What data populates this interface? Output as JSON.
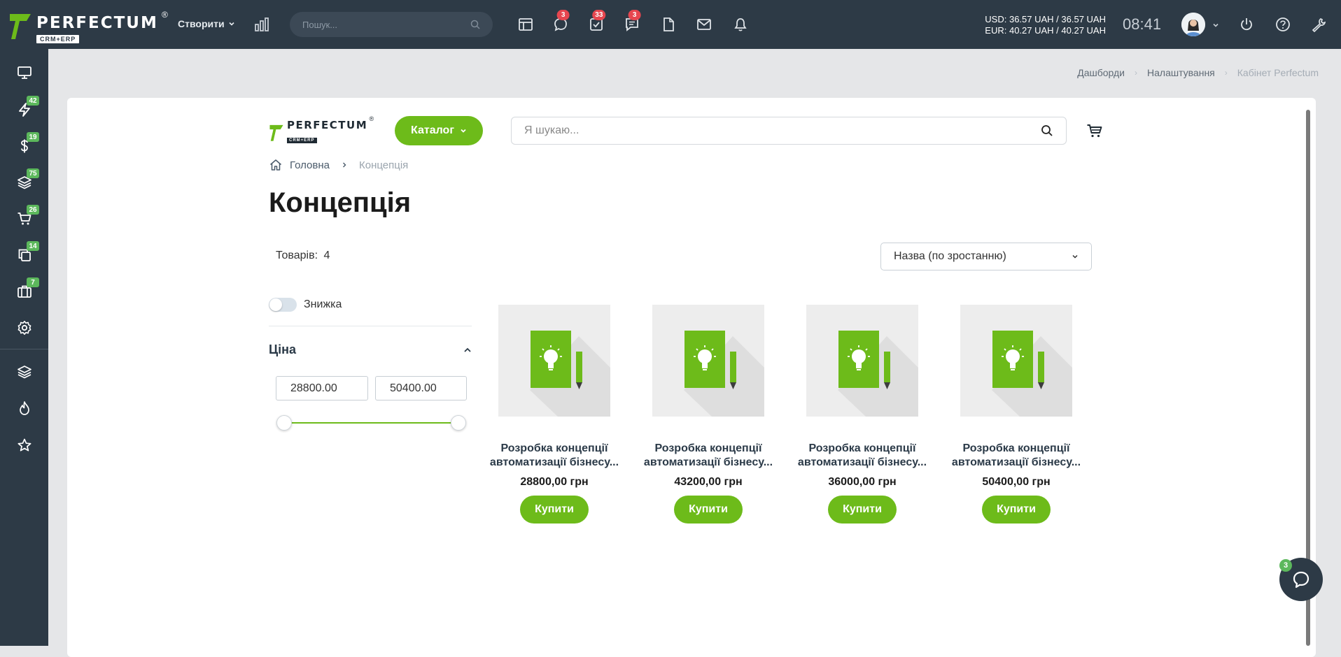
{
  "topbar": {
    "brand": "PERFECTUM",
    "brand_sub": "CRM+ERP",
    "brand_reg": "®",
    "create_label": "Створити",
    "search_placeholder": "Пошук...",
    "badges": {
      "chat": "3",
      "tasks": "33",
      "messages": "3"
    },
    "currency_usd": "USD: 36.57 UAH / 36.57 UAH",
    "currency_eur": "EUR: 40.27 UAH / 40.27 UAH",
    "clock": "08:41"
  },
  "sidebar": {
    "badges": {
      "activity": "42",
      "finance": "19",
      "products": "75",
      "cart": "26",
      "documents": "14",
      "cases": "7"
    }
  },
  "breadcrumb_top": {
    "dashboards": "Дашборди",
    "settings": "Налаштування",
    "cabinet": "Кабінет Perfectum"
  },
  "shop": {
    "brand": "PERFECTUM",
    "brand_sub": "CRM+ERP",
    "brand_reg": "®",
    "catalog_label": "Каталог",
    "search_placeholder": "Я шукаю...",
    "crumb_home": "Головна",
    "crumb_current": "Концепція",
    "title": "Концепція",
    "count_label": "Товарів:",
    "count_value": "4",
    "sort_value": "Назва (по зростанню)",
    "discount_label": "Знижка",
    "price_label": "Ціна",
    "price_min": "28800.00",
    "price_max": "50400.00"
  },
  "products": [
    {
      "line1": "Розробка концепції",
      "line2": "автоматизації бізнесу...",
      "price": "28800,00 грн",
      "buy": "Купити"
    },
    {
      "line1": "Розробка концепції",
      "line2": "автоматизації бізнесу...",
      "price": "43200,00 грн",
      "buy": "Купити"
    },
    {
      "line1": "Розробка концепції",
      "line2": "автоматизації бізнесу...",
      "price": "36000,00 грн",
      "buy": "Купити"
    },
    {
      "line1": "Розробка концепції",
      "line2": "автоматизації бізнесу...",
      "price": "50400,00 грн",
      "buy": "Купити"
    }
  ],
  "chat": {
    "badge": "3"
  },
  "colors": {
    "accent_green": "#6dbb1a",
    "nav_dark": "#2d3a46",
    "badge_red": "#e7464f",
    "badge_green": "#5cb85c"
  }
}
